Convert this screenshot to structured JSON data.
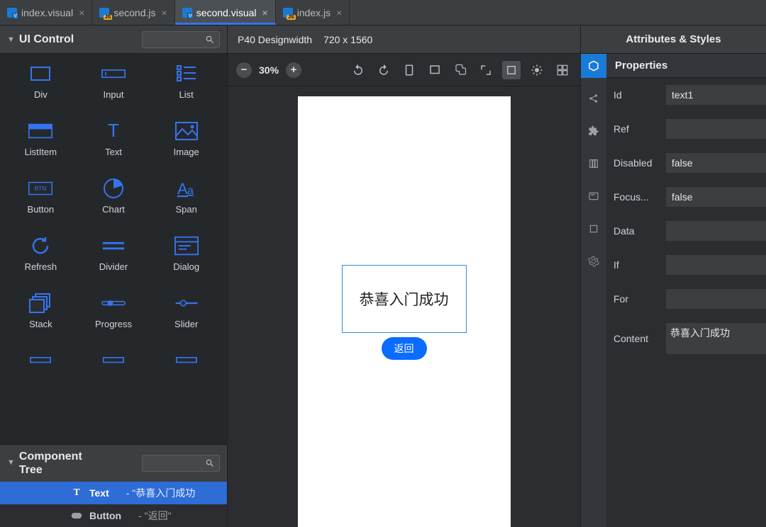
{
  "tabs": [
    {
      "label": "index.visual",
      "type": "visual",
      "active": false
    },
    {
      "label": "second.js",
      "type": "js",
      "active": false
    },
    {
      "label": "second.visual",
      "type": "visual",
      "active": true
    },
    {
      "label": "index.js",
      "type": "js",
      "active": false
    }
  ],
  "palette": {
    "title": "UI Control",
    "items": [
      {
        "label": "Div"
      },
      {
        "label": "Input"
      },
      {
        "label": "List"
      },
      {
        "label": "ListItem"
      },
      {
        "label": "Text"
      },
      {
        "label": "Image"
      },
      {
        "label": "Button"
      },
      {
        "label": "Chart"
      },
      {
        "label": "Span"
      },
      {
        "label": "Refresh"
      },
      {
        "label": "Divider"
      },
      {
        "label": "Dialog"
      },
      {
        "label": "Stack"
      },
      {
        "label": "Progress"
      },
      {
        "label": "Slider"
      }
    ]
  },
  "tree": {
    "title": "Component Tree",
    "rows": [
      {
        "label": "Text",
        "value": "- \"恭喜入门成功",
        "selected": true,
        "icon": "T"
      },
      {
        "label": "Button",
        "value": "- \"返回\"",
        "selected": false,
        "icon": "btn"
      }
    ]
  },
  "designBar": {
    "device": "P40 Designwidth",
    "dims": "720 x 1560"
  },
  "toolbar": {
    "zoom": "30%"
  },
  "preview": {
    "textContent": "恭喜入门成功",
    "buttonLabel": "返回"
  },
  "rightHeader": "Attributes & Styles",
  "properties": {
    "title": "Properties",
    "rows": [
      {
        "label": "Id",
        "value": "text1"
      },
      {
        "label": "Ref",
        "value": ""
      },
      {
        "label": "Disabled",
        "value": "false"
      },
      {
        "label": "Focus...",
        "value": "false"
      },
      {
        "label": "Data",
        "value": ""
      },
      {
        "label": "If",
        "value": ""
      },
      {
        "label": "For",
        "value": ""
      }
    ],
    "content": {
      "label": "Content",
      "value": "恭喜入门成功"
    }
  }
}
